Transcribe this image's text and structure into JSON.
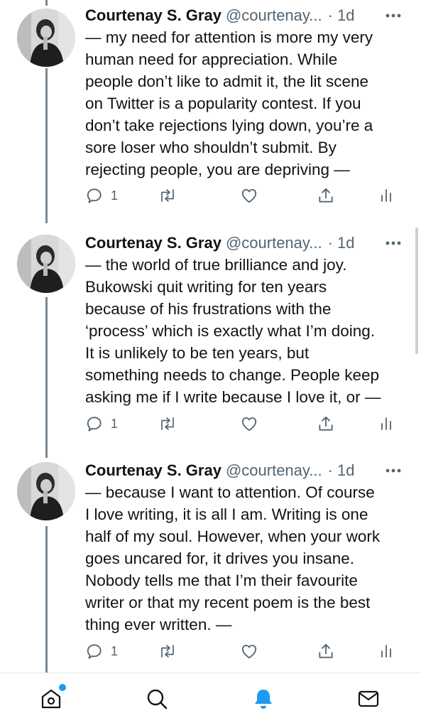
{
  "colors": {
    "accent": "#1d9bf0",
    "text": "#0f1419",
    "muted": "#536471",
    "thread": "#7b8894"
  },
  "tweets": [
    {
      "name": "Courtenay S. Gray",
      "handle": "@courtenay...",
      "time": "· 1d",
      "lines": [
        "— my need for attention is more my very",
        "human need for appreciation. While",
        "people don’t like to admit it, the lit scene",
        "on Twitter is a popularity contest. If you",
        "don’t take rejections lying down, you’re a",
        "sore loser who shouldn’t submit. By",
        "rejecting people, you are depriving —"
      ],
      "replies": "1"
    },
    {
      "name": "Courtenay S. Gray",
      "handle": "@courtenay...",
      "time": "· 1d",
      "lines": [
        "— the world of true brilliance and joy.",
        "Bukowski quit writing for ten years",
        "because of his frustrations with the",
        "‘process’ which is exactly what I’m doing.",
        "It is unlikely to be ten years, but",
        "something needs to change. People keep",
        "asking me if I write because I love it, or —"
      ],
      "replies": "1"
    },
    {
      "name": "Courtenay S. Gray",
      "handle": "@courtenay...",
      "time": "· 1d",
      "lines": [
        "— because I want to attention. Of course",
        "I love writing, it is all I am. Writing is one",
        "half of my soul. However, when your work",
        "goes uncared for, it drives you insane.",
        "Nobody tells me that I’m their favourite",
        "writer or that my recent poem is the best",
        "thing ever written. —"
      ],
      "replies": "1"
    }
  ],
  "icons": {
    "tweet": [
      "avatar",
      "more-icon",
      "reply-icon",
      "retweet-icon",
      "like-icon",
      "share-icon",
      "analytics-icon"
    ],
    "nav": [
      "home-icon",
      "search-icon",
      "notifications-icon",
      "messages-icon"
    ]
  }
}
